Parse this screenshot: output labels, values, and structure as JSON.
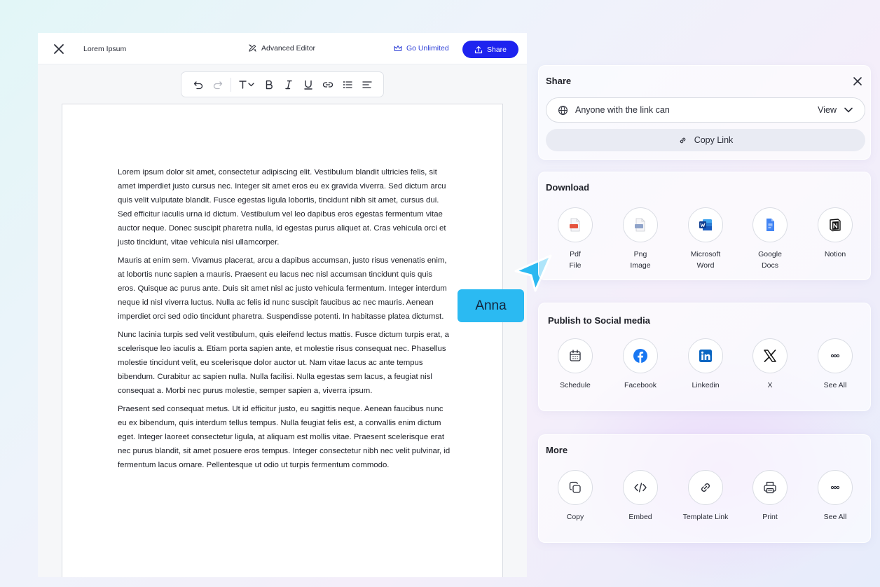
{
  "editor": {
    "doc_title": "Lorem Ipsum",
    "advanced_editor": "Advanced Editor",
    "go_unlimited": "Go Unlimited",
    "share": "Share",
    "paragraphs": [
      "Lorem ipsum dolor sit amet, consectetur adipiscing elit. Vestibulum blandit ultricies felis, sit amet imperdiet justo cursus nec. Integer sit amet eros eu ex gravida viverra. Sed dictum arcu quis velit vulputate blandit. Fusce egestas ligula lobortis, tincidunt nibh sit amet, cursus dui. Sed efficitur iaculis urna id dictum. Vestibulum vel leo dapibus eros egestas fermentum vitae auctor neque. Donec suscipit pharetra nulla, id egestas purus aliquet at. Cras vehicula orci et justo tincidunt, vitae vehicula nisi ullamcorper.",
      "Mauris at enim sem. Vivamus placerat, arcu a dapibus accumsan, justo risus venenatis enim, at lobortis nunc sapien a mauris. Praesent eu lacus nec nisl accumsan tincidunt quis quis eros. Quisque ac purus ante. Duis sit amet nisl ac justo vehicula fermentum. Integer interdum neque id nisl viverra luctus. Nulla ac felis id nunc suscipit faucibus ac nec mauris. Aenean imperdiet orci sed odio tincidunt pharetra. Suspendisse potenti. In habitasse platea dictumst.",
      "Nunc lacinia turpis sed velit vestibulum, quis eleifend lectus mattis. Fusce dictum turpis erat, a scelerisque leo iaculis a. Etiam porta sapien ante, et molestie risus consequat nec. Phasellus molestie tincidunt velit, eu scelerisque dolor auctor ut. Nam vitae lacus ac ante tempus bibendum. Curabitur ac sapien nulla. Nulla facilisi. Nulla egestas sem lacus, a feugiat nisl consequat a. Morbi nec purus molestie, semper sapien a, viverra ipsum.",
      "Praesent sed consequat metus. Ut id efficitur justo, eu sagittis neque. Aenean faucibus nunc eu ex bibendum, quis interdum tellus tempus. Nulla feugiat felis est, a convallis enim dictum eget. Integer laoreet consectetur ligula, at aliquam est mollis vitae. Praesent scelerisque erat nec purus blandit, sit amet posuere eros tempus. Integer consectetur nibh nec velit pulvinar, id fermentum lacus ornare. Pellentesque ut odio ut turpis fermentum commodo."
    ]
  },
  "cursor": {
    "name": "Anna"
  },
  "share_panel": {
    "title": "Share",
    "access_label": "Anyone with the link can",
    "access_value": "View",
    "copy_link": "Copy Link"
  },
  "download": {
    "title": "Download",
    "items": [
      {
        "label": "Pdf\nFile",
        "icon": "pdf-file-icon"
      },
      {
        "label": "Png\nImage",
        "icon": "png-image-icon"
      },
      {
        "label": "Microsoft\nWord",
        "icon": "word-icon"
      },
      {
        "label": "Google\nDocs",
        "icon": "google-docs-icon"
      },
      {
        "label": "Notion",
        "icon": "notion-icon"
      }
    ]
  },
  "social": {
    "title": "Publish to Social media",
    "items": [
      {
        "label": "Schedule",
        "icon": "calendar-icon"
      },
      {
        "label": "Facebook",
        "icon": "facebook-icon"
      },
      {
        "label": "Linkedin",
        "icon": "linkedin-icon"
      },
      {
        "label": "X",
        "icon": "x-icon"
      },
      {
        "label": "See All",
        "icon": "more-icon"
      }
    ]
  },
  "more": {
    "title": "More",
    "items": [
      {
        "label": "Copy",
        "icon": "copy-icon"
      },
      {
        "label": "Embed",
        "icon": "embed-icon"
      },
      {
        "label": "Template Link",
        "icon": "link-icon"
      },
      {
        "label": "Print",
        "icon": "print-icon"
      },
      {
        "label": "See All",
        "icon": "more-icon"
      }
    ]
  },
  "colors": {
    "accent": "#1e23ef",
    "cursor": "#2bbaf2",
    "facebook": "#1877f2",
    "linkedin": "#0a66c2",
    "pdf": "#e5533d",
    "word": "#185abd",
    "google_docs": "#4285f4"
  }
}
